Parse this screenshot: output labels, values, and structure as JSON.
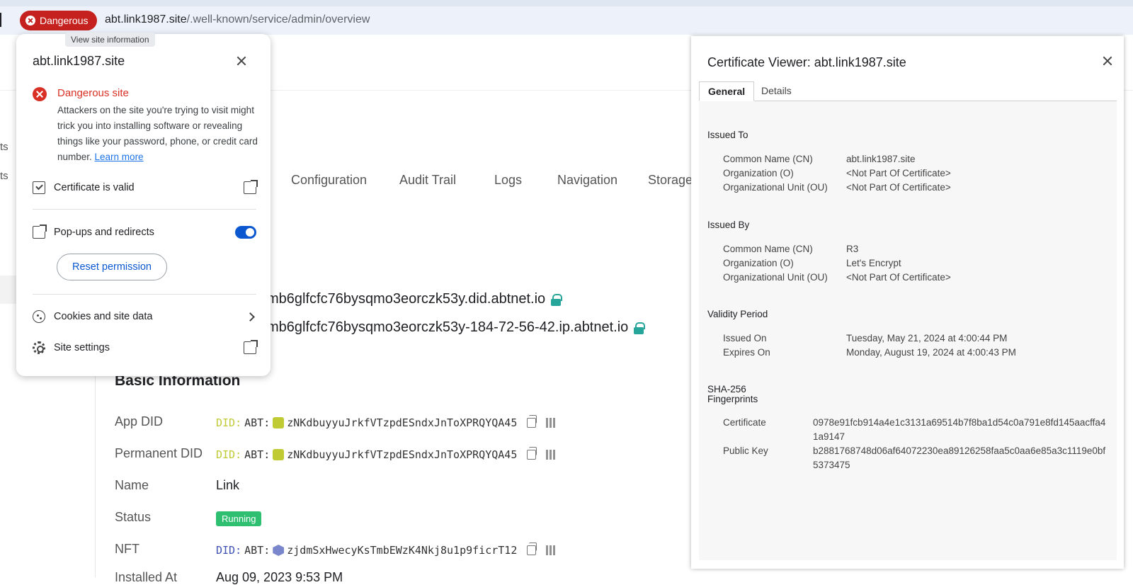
{
  "browser": {
    "security_chip": "Dangerous",
    "url_host": "abt.link1987.site",
    "url_path": "/.well-known/service/admin/overview",
    "tooltip": "View site information"
  },
  "site_popup": {
    "title": "abt.link1987.site",
    "danger_heading": "Dangerous site",
    "danger_text": "Attackers on the site you're trying to visit might trick you into installing software or revealing things like your password, phone, or credit card number. ",
    "learn_more": "Learn more",
    "certificate": "Certificate is valid",
    "popups": "Pop-ups and redirects",
    "popups_enabled": true,
    "reset": "Reset permission",
    "cookies": "Cookies and site data",
    "site_settings": "Site settings"
  },
  "page": {
    "left_fragments": [
      "ts",
      "ts"
    ],
    "tabs": [
      "Configuration",
      "Audit Trail",
      "Logs",
      "Navigation",
      "Storage"
    ],
    "domain1": "mb6glfcfc76bysqmo3eorczk53y.did.abtnet.io",
    "domain2": "mb6glfcfc76bysqmo3eorczk53y-184-72-56-42.ip.abtnet.io",
    "basic_title": "Basic Information",
    "app_did_label": "App DID",
    "app_did_prefix": "DID:",
    "app_did_abt": "ABT:",
    "app_did_value": "zNKdbuyyuJrkfVTzpdESndxJnToXPRQYQA45",
    "perm_did_label": "Permanent DID",
    "perm_did_prefix": "DID:",
    "perm_did_abt": "ABT:",
    "perm_did_value": "zNKdbuyyuJrkfVTzpdESndxJnToXPRQYQA45",
    "name_label": "Name",
    "name_value": "Link",
    "status_label": "Status",
    "status_value": "Running",
    "nft_label": "NFT",
    "nft_prefix": "DID:",
    "nft_abt": "ABT:",
    "nft_value": "zjdmSxHwecyKsTmbEWzK4Nkj8u1p9ficrT12",
    "installed_label": "Installed At",
    "installed_value": "Aug 09, 2023 9:53 PM"
  },
  "cert_viewer": {
    "title": "Certificate Viewer: abt.link1987.site",
    "tabs": [
      "General",
      "Details"
    ],
    "issued_to": {
      "title": "Issued To",
      "cn_label": "Common Name (CN)",
      "cn": "abt.link1987.site",
      "o_label": "Organization (O)",
      "o": "<Not Part Of Certificate>",
      "ou_label": "Organizational Unit (OU)",
      "ou": "<Not Part Of Certificate>"
    },
    "issued_by": {
      "title": "Issued By",
      "cn_label": "Common Name (CN)",
      "cn": "R3",
      "o_label": "Organization (O)",
      "o": "Let's Encrypt",
      "ou_label": "Organizational Unit (OU)",
      "ou": "<Not Part Of Certificate>"
    },
    "validity": {
      "title": "Validity Period",
      "issued_label": "Issued On",
      "issued": "Tuesday, May 21, 2024 at 4:00:44 PM",
      "expires_label": "Expires On",
      "expires": "Monday, August 19, 2024 at 4:00:43 PM"
    },
    "fingerprints": {
      "title_line1": "SHA-256",
      "title_line2": "Fingerprints",
      "cert_label": "Certificate",
      "cert": "0978e91fcb914a4e1c3131a69514b7f8ba1d54c0a791e8fd145aacffa41a9147",
      "key_label": "Public Key",
      "key": "b2881768748d06af64072230ea89126258faa5c0aa6e85a3c1119e0bf5373475"
    }
  },
  "colors": {
    "danger": "#d93025",
    "chip": "#c5221f",
    "link": "#1a73e8",
    "toggle": "#0b57d0",
    "running": "#2fbf71",
    "lock": "#26a69a"
  }
}
